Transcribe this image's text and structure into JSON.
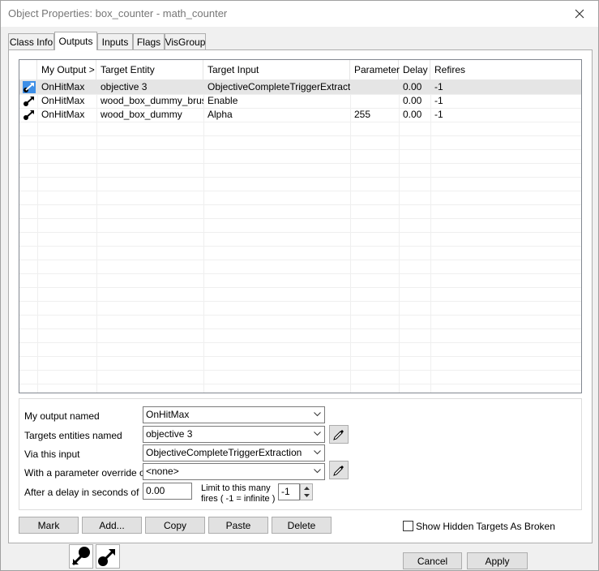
{
  "window": {
    "title": "Object Properties: box_counter - math_counter"
  },
  "tabs": [
    {
      "label": "Class Info"
    },
    {
      "label": "Outputs"
    },
    {
      "label": "Inputs"
    },
    {
      "label": "Flags"
    },
    {
      "label": "VisGroup"
    }
  ],
  "outputs_table": {
    "columns": [
      "My Output  >",
      "Target Entity",
      "Target Input",
      "Parameter",
      "Delay",
      "Refires"
    ],
    "rows": [
      {
        "output": "OnHitMax",
        "target": "objective 3",
        "input": "ObjectiveCompleteTriggerExtraction",
        "parameter": "",
        "delay": "0.00",
        "refires": "-1",
        "selected": true
      },
      {
        "output": "OnHitMax",
        "target": "wood_box_dummy_brush",
        "input": "Enable",
        "parameter": "",
        "delay": "0.00",
        "refires": "-1",
        "selected": false
      },
      {
        "output": "OnHitMax",
        "target": "wood_box_dummy",
        "input": "Alpha",
        "parameter": "255",
        "delay": "0.00",
        "refires": "-1",
        "selected": false
      }
    ]
  },
  "editor": {
    "output_label": "My output named",
    "output_value": "OnHitMax",
    "target_label": "Targets entities named",
    "target_value": "objective 3",
    "input_label": "Via this input",
    "input_value": "ObjectiveCompleteTriggerExtraction",
    "param_label": "With a parameter override of",
    "param_value": "<none>",
    "delay_label": "After a delay in seconds of",
    "delay_value": "0.00",
    "limit_label_1": "Limit to this many",
    "limit_label_2": "fires ( -1 = infinite )",
    "limit_value": "-1"
  },
  "buttons": {
    "mark": "Mark",
    "add": "Add...",
    "copy": "Copy",
    "paste": "Paste",
    "delete": "Delete",
    "show_hidden": "Show Hidden Targets As Broken",
    "cancel": "Cancel",
    "apply": "Apply"
  },
  "icons": {
    "row_icon": "output-connection-icon",
    "eyedropper": "eyedropper-icon",
    "outputs_mode": "outputs-mode-icon",
    "inputs_mode": "inputs-mode-icon"
  },
  "colors": {
    "selected_row": "#e5e5e5",
    "row_icon_selected_bg": "#3d8ee6"
  }
}
